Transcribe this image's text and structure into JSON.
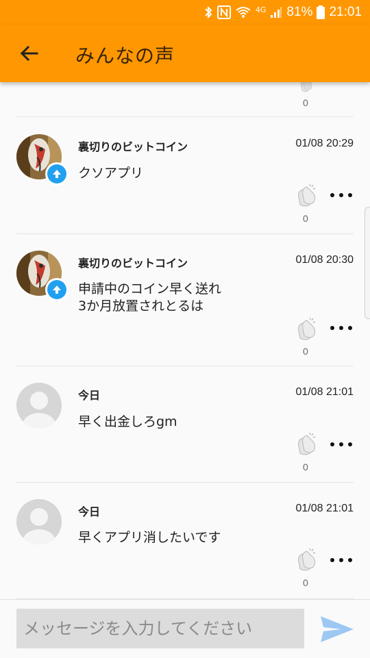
{
  "status_bar": {
    "battery_percent": "81%",
    "time": "21:01",
    "network": "4G",
    "icons": [
      "bluetooth-icon",
      "nfc-icon",
      "wifi-icon",
      "signal-icon",
      "battery-icon"
    ]
  },
  "header": {
    "title": "みんなの声",
    "back_icon": "arrow-left-icon"
  },
  "top_partial": {
    "clap_count": "0"
  },
  "messages": [
    {
      "name": "裏切りのビットコイン",
      "time": "01/08 20:29",
      "text": "クソアプリ",
      "text2": "",
      "claps": "0",
      "avatar": "custom",
      "badge": "upload-icon"
    },
    {
      "name": "裏切りのビットコイン",
      "time": "01/08 20:30",
      "text": "申請中のコイン早く送れ",
      "text2": "3か月放置されとるは",
      "claps": "0",
      "avatar": "custom",
      "badge": "upload-icon"
    },
    {
      "name": "今日",
      "time": "01/08 21:01",
      "text": "早く出金しろgm",
      "text2": "",
      "claps": "0",
      "avatar": "default",
      "badge": ""
    },
    {
      "name": "今日",
      "time": "01/08 21:01",
      "text": "早くアプリ消したいです",
      "text2": "",
      "claps": "0",
      "avatar": "default",
      "badge": ""
    }
  ],
  "composer": {
    "placeholder": "メッセージを入力してください",
    "send_icon": "send-icon"
  },
  "colors": {
    "accent": "#ff9702",
    "badge": "#22a0f0",
    "send": "#9cc8f3"
  }
}
